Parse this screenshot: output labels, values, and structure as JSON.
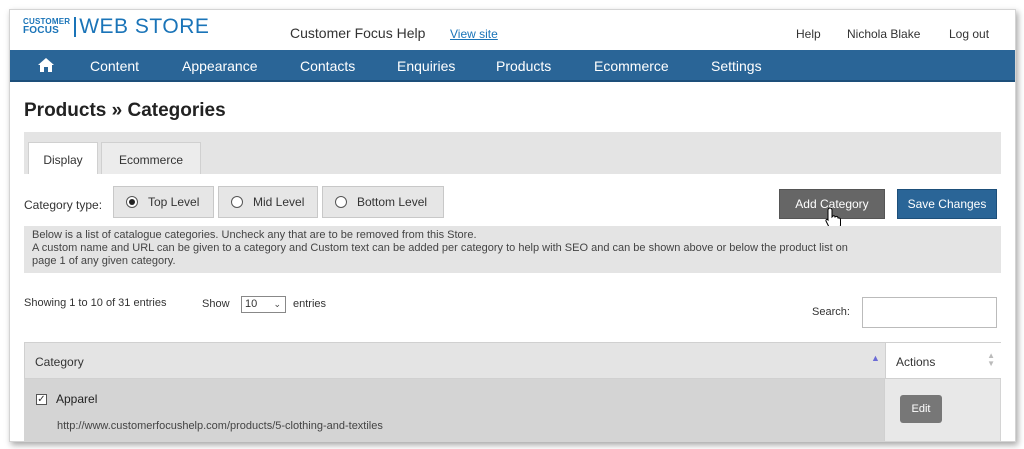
{
  "header": {
    "logo_small_line1": "CUSTOMER",
    "logo_small_line2": "FOCUS",
    "logo_big": "WEB STORE",
    "site_title": "Customer Focus Help",
    "view_site": "View site",
    "help": "Help",
    "user": "Nichola Blake",
    "logout": "Log out"
  },
  "nav": {
    "home_icon": "home-icon",
    "items": [
      "Content",
      "Appearance",
      "Contacts",
      "Enquiries",
      "Products",
      "Ecommerce",
      "Settings"
    ]
  },
  "page_title": "Products » Categories",
  "tabs": [
    "Display",
    "Ecommerce"
  ],
  "category_type": {
    "label": "Category type:",
    "options": [
      "Top Level",
      "Mid Level",
      "Bottom Level"
    ],
    "selected": "Top Level"
  },
  "buttons": {
    "add_category": "Add Category",
    "save_changes": "Save Changes"
  },
  "info": {
    "line1": "Below is a list of catalogue categories. Uncheck any that are to be removed from this Store.",
    "line2": "A custom name and URL can be given to a category and Custom text can be added per category to help with SEO and can be shown above or below the product list on",
    "line3": "page 1 of any given category."
  },
  "list_controls": {
    "showing": "Showing 1 to 10 of 31 entries",
    "show_label": "Show",
    "page_size": "10",
    "entries_label": "entries",
    "search_label": "Search:",
    "search_value": ""
  },
  "table": {
    "columns": [
      "Category",
      "Actions"
    ],
    "rows": [
      {
        "checked": true,
        "name": "Apparel",
        "url": "http://www.customerfocushelp.com/products/5-clothing-and-textiles",
        "action": "Edit"
      }
    ]
  },
  "colors": {
    "brand_blue": "#1a74b8",
    "nav_bg": "#2a6597",
    "save_button": "#2a6597",
    "add_button": "#666666"
  }
}
